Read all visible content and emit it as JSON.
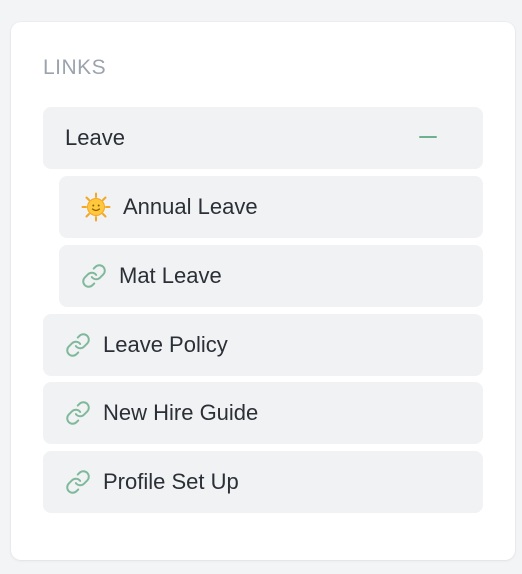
{
  "section_title": "LINKS",
  "group": {
    "label": "Leave",
    "toggle_icon": "minus-icon",
    "children": [
      {
        "label": "Annual Leave",
        "icon": "sun-icon"
      },
      {
        "label": "Mat Leave",
        "icon": "link-icon"
      }
    ]
  },
  "links": [
    {
      "label": "Leave Policy",
      "icon": "link-icon"
    },
    {
      "label": "New Hire Guide",
      "icon": "link-icon"
    },
    {
      "label": "Profile Set Up",
      "icon": "link-icon"
    }
  ],
  "colors": {
    "accent": "#6fb08f",
    "item_bg": "#f0f2f4",
    "section_title": "#9ca3af",
    "text": "#2b2f36"
  }
}
